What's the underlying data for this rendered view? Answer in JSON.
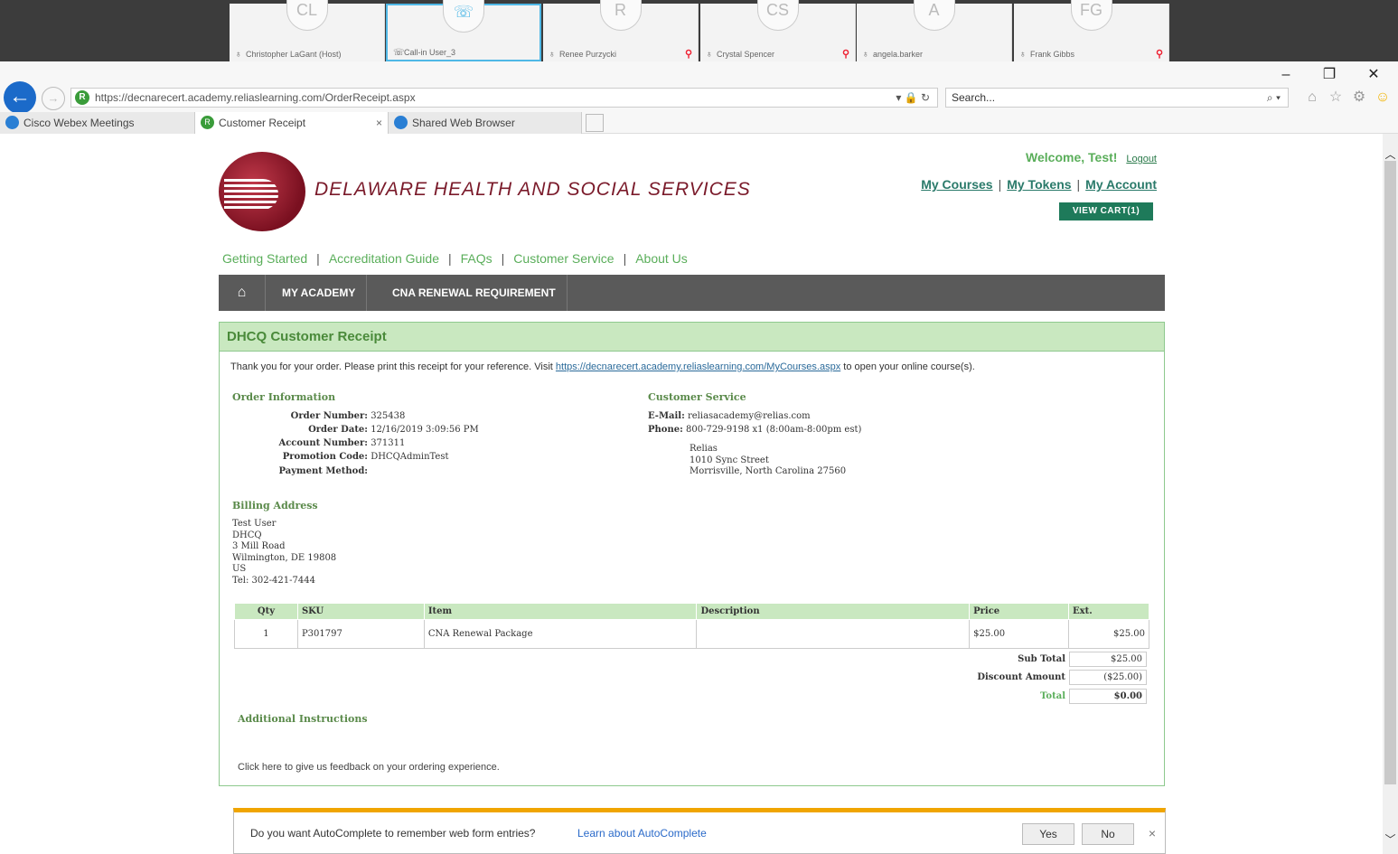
{
  "webex": {
    "participants": [
      {
        "initials": "CL",
        "name": "Christopher LaGant (Host)",
        "muted": false,
        "active": false
      },
      {
        "initials": "☏",
        "name": "Call-in User_3",
        "muted": false,
        "active": true
      },
      {
        "initials": "R",
        "name": "Renee Purzycki",
        "muted": true,
        "active": false
      },
      {
        "initials": "CS",
        "name": "Crystal Spencer",
        "muted": true,
        "active": false
      },
      {
        "initials": "A",
        "name": "angela.barker",
        "muted": false,
        "active": false
      },
      {
        "initials": "FG",
        "name": "Frank Gibbs",
        "muted": true,
        "active": false
      }
    ]
  },
  "browser": {
    "url": "https://decnarecert.academy.reliaslearning.com/OrderReceipt.aspx",
    "search_placeholder": "Search...",
    "tabs": [
      {
        "label": "Cisco Webex Meetings"
      },
      {
        "label": "Customer Receipt"
      },
      {
        "label": "Shared Web Browser"
      }
    ]
  },
  "header": {
    "org_name": "DELAWARE HEALTH AND SOCIAL SERVICES",
    "welcome": "Welcome, Test!",
    "logout": "Logout",
    "links": [
      "My Courses",
      "My Tokens",
      "My Account"
    ],
    "view_cart": "VIEW CART(1)"
  },
  "subnav": [
    "Getting Started",
    "Accreditation Guide",
    "FAQs",
    "Customer Service",
    "About Us"
  ],
  "mainnav": [
    "MY ACADEMY",
    "CNA RENEWAL REQUIREMENT"
  ],
  "receipt": {
    "title": "DHCQ Customer Receipt",
    "thanks_pre": "Thank you for your order. Please print this receipt for your reference. Visit",
    "thanks_link": "https://decnarecert.academy.reliaslearning.com/MyCourses.aspx",
    "thanks_post": "to open your online course(s).",
    "order_info_title": "Order Information",
    "order_number_label": "Order Number:",
    "order_number": "325438",
    "order_date_label": "Order Date:",
    "order_date": "12/16/2019 3:09:56 PM",
    "account_number_label": "Account Number:",
    "account_number": "371311",
    "promo_label": "Promotion Code:",
    "promo": "DHCQAdminTest",
    "payment_label": "Payment Method:",
    "payment": "",
    "cs_title": "Customer Service",
    "email_label": "E-Mail:",
    "email": "reliasacademy@relias.com",
    "phone_label": "Phone:",
    "phone": "800-729-9198 x1 (8:00am-8:00pm est)",
    "cs_address": [
      "Relias",
      "1010 Sync Street",
      "Morrisville, North Carolina 27560"
    ],
    "billing_title": "Billing Address",
    "billing": [
      "Test User",
      "DHCQ",
      "3 Mill Road",
      "Wilmington, DE 19808",
      "US",
      "Tel: 302-421-7444"
    ],
    "table_headers": [
      "Qty",
      "SKU",
      "Item",
      "Description",
      "Price",
      "Ext."
    ],
    "rows": [
      {
        "qty": "1",
        "sku": "P301797",
        "item": "CNA Renewal Package",
        "description": "",
        "price": "$25.00",
        "ext": "$25.00"
      }
    ],
    "subtotal_label": "Sub Total",
    "subtotal": "$25.00",
    "discount_label": "Discount Amount",
    "discount": "($25.00)",
    "total_label": "Total",
    "total": "$0.00",
    "additional_title": "Additional Instructions",
    "feedback": "Click here to give us feedback on your ordering experience."
  },
  "autocomplete": {
    "message": "Do you want AutoComplete to remember web form entries?",
    "learn": "Learn about AutoComplete",
    "yes": "Yes",
    "no": "No"
  },
  "colors": {
    "accent_green": "#5aae5a",
    "header_green": "#c9e8c0",
    "brand_maroon": "#7a1a2a",
    "nav_gray": "#5a5a5a",
    "cart_green": "#1e7a5a"
  }
}
